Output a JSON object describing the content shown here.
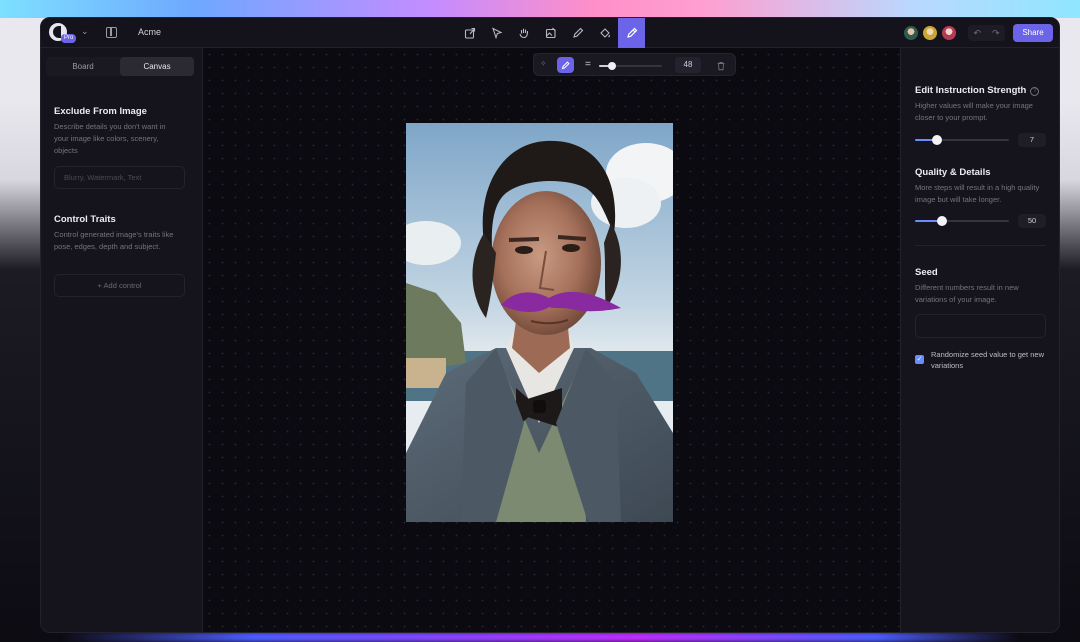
{
  "app": {
    "project_name": "Acme",
    "logo_badge": "Pro",
    "share_label": "Share"
  },
  "toolbar": {
    "tools": [
      {
        "name": "export",
        "icon": "export-icon"
      },
      {
        "name": "select",
        "icon": "cursor-icon"
      },
      {
        "name": "pan",
        "icon": "hand-icon"
      },
      {
        "name": "image-edit",
        "icon": "image-edit-icon"
      },
      {
        "name": "pen",
        "icon": "pen-icon"
      },
      {
        "name": "fill",
        "icon": "paint-bucket-icon"
      },
      {
        "name": "brush",
        "icon": "brush-icon",
        "active": true
      }
    ]
  },
  "left_panel": {
    "tabs": [
      {
        "label": "Board",
        "active": false
      },
      {
        "label": "Canvas",
        "active": true
      }
    ],
    "exclude": {
      "title": "Exclude From Image",
      "description": "Describe details you don't want in your image like colors, scenery, objects",
      "placeholder": "Blurry, Watermark, Text"
    },
    "control": {
      "title": "Control Traits",
      "description": "Control generated image's traits like pose, edges, depth and subject.",
      "add_label": "+ Add control"
    }
  },
  "brush_bar": {
    "size_value": "48",
    "size_fraction": 0.2
  },
  "right_panel": {
    "strength": {
      "title": "Edit Instruction Strength",
      "description": "Higher values will make your image closer to your prompt.",
      "value": "7",
      "fraction": 0.23
    },
    "quality": {
      "title": "Quality & Details",
      "description": "More steps will result in a high quality image but will take longer.",
      "value": "50",
      "fraction": 0.29
    },
    "seed": {
      "title": "Seed",
      "description": "Different numbers result in new variations of your image.",
      "randomize_label": "Randomize seed value to get new variations",
      "randomize_checked": true
    }
  },
  "colors": {
    "accent": "#6b63e8",
    "slider_accent": "#6b8cff"
  }
}
